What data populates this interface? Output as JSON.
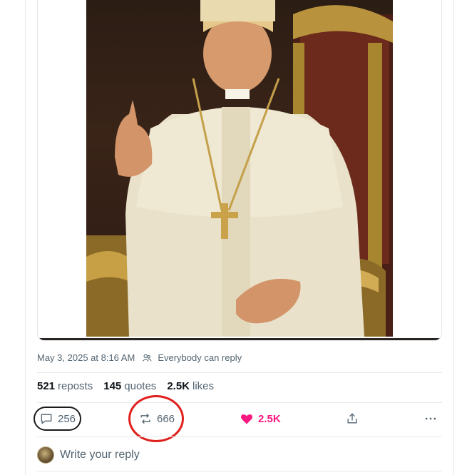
{
  "post": {
    "timestamp": "May 3, 2025 at 8:16 AM",
    "reply_setting": "Everybody can reply",
    "stats": {
      "reposts_count": "521",
      "reposts_label": "reposts",
      "quotes_count": "145",
      "quotes_label": "quotes",
      "likes_count": "2.5K",
      "likes_label": "likes"
    },
    "actions": {
      "reply_count": "256",
      "repost_count": "666",
      "like_count": "2.5K"
    },
    "reply_placeholder": "Write your reply"
  },
  "colors": {
    "like": "#f91880",
    "annotation": "#e0201c",
    "muted": "#536471"
  },
  "icons": [
    "comment-icon",
    "repost-icon",
    "heart-icon",
    "share-icon",
    "more-icon",
    "people-icon"
  ]
}
